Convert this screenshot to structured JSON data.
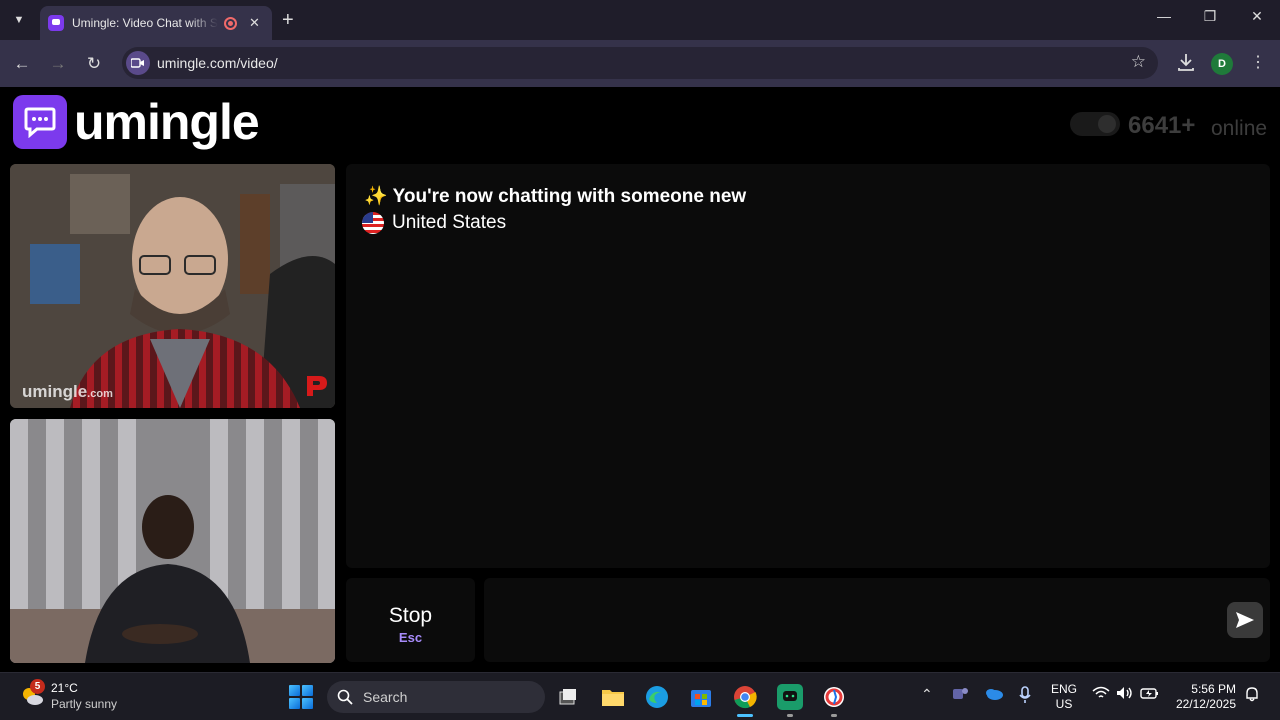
{
  "browser": {
    "tab_title": "Umingle: Video Chat with Strangers",
    "url": "umingle.com/video/",
    "profile_initial": "D"
  },
  "page": {
    "logo_text": "umingle",
    "online_count": "6641+",
    "online_label": "online",
    "remote_video_watermark": "umingle",
    "remote_video_watermark_suffix": ".com",
    "chat": {
      "system_message": "✨ You're now chatting with someone new",
      "partner_country": "United States"
    },
    "stop_button": {
      "label": "Stop",
      "shortcut": "Esc"
    },
    "message_input_placeholder": ""
  },
  "taskbar": {
    "weather_badge": "5",
    "temperature": "21°C",
    "weather_desc": "Partly sunny",
    "search_placeholder": "Search",
    "lang_line1": "ENG",
    "lang_line2": "US",
    "time": "5:56 PM",
    "date": "22/12/2025"
  },
  "colors": {
    "brand": "#7c3aed",
    "chrome_bg": "#35324a",
    "panel_bg": "#0b0b0b"
  }
}
